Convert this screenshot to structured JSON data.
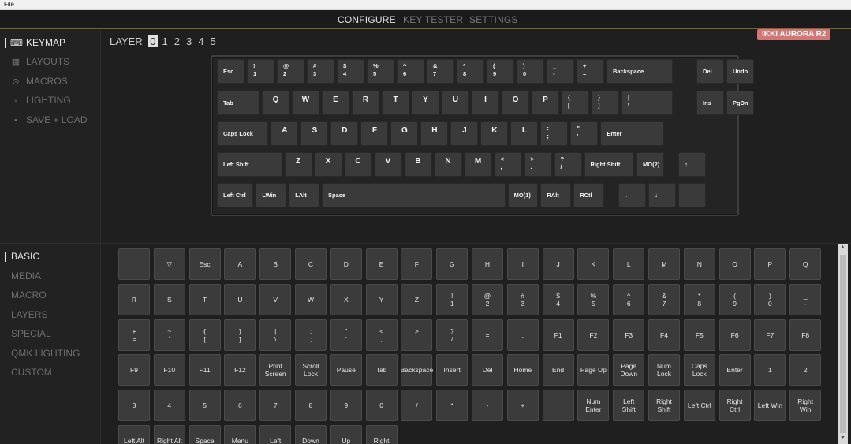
{
  "menubar": {
    "file": "File"
  },
  "topnav": {
    "tabs": [
      "CONFIGURE",
      "KEY TESTER",
      "SETTINGS"
    ]
  },
  "leftnav": {
    "items": [
      {
        "label": "KEYMAP",
        "icon": "keyboard-icon",
        "glyph": "⌨"
      },
      {
        "label": "LAYOUTS",
        "icon": "layouts-icon",
        "glyph": "▦"
      },
      {
        "label": "MACROS",
        "icon": "macros-icon",
        "glyph": "⊙"
      },
      {
        "label": "LIGHTING",
        "icon": "lightbulb-icon",
        "glyph": "♀"
      },
      {
        "label": "SAVE + LOAD",
        "icon": "save-icon",
        "glyph": "▪"
      }
    ]
  },
  "layer": {
    "label": "LAYER",
    "numbers": [
      "0",
      "1",
      "2",
      "3",
      "4",
      "5"
    ]
  },
  "device": {
    "name": "IKKI AURORA R2"
  },
  "keyboard": {
    "rows": [
      [
        [
          "Esc",
          ""
        ],
        [
          "!",
          "1"
        ],
        [
          "@",
          "2"
        ],
        [
          "#",
          "3"
        ],
        [
          "$",
          "4"
        ],
        [
          "%",
          "5"
        ],
        [
          "^",
          "6"
        ],
        [
          "&",
          "7"
        ],
        [
          "*",
          "8"
        ],
        [
          "(",
          "9"
        ],
        [
          ")",
          "0"
        ],
        [
          "_",
          "-"
        ],
        [
          "+",
          "="
        ],
        [
          "Backspace",
          ""
        ],
        [
          "Del",
          ""
        ],
        [
          "Undo",
          ""
        ]
      ],
      [
        [
          "Tab",
          ""
        ],
        [
          "Q",
          ""
        ],
        [
          "W",
          ""
        ],
        [
          "E",
          ""
        ],
        [
          "R",
          ""
        ],
        [
          "T",
          ""
        ],
        [
          "Y",
          ""
        ],
        [
          "U",
          ""
        ],
        [
          "I",
          ""
        ],
        [
          "O",
          ""
        ],
        [
          "P",
          ""
        ],
        [
          "{",
          "["
        ],
        [
          "}",
          "]"
        ],
        [
          "|",
          "\\"
        ],
        [
          "Ins",
          ""
        ],
        [
          "PgDn",
          ""
        ]
      ],
      [
        [
          "Caps Lock",
          ""
        ],
        [
          "A",
          ""
        ],
        [
          "S",
          ""
        ],
        [
          "D",
          ""
        ],
        [
          "F",
          ""
        ],
        [
          "G",
          ""
        ],
        [
          "H",
          ""
        ],
        [
          "J",
          ""
        ],
        [
          "K",
          ""
        ],
        [
          "L",
          ""
        ],
        [
          ":",
          ";"
        ],
        [
          "\"",
          "'"
        ],
        [
          "Enter",
          ""
        ]
      ],
      [
        [
          "Left Shift",
          ""
        ],
        [
          "Z",
          ""
        ],
        [
          "X",
          ""
        ],
        [
          "C",
          ""
        ],
        [
          "V",
          ""
        ],
        [
          "B",
          ""
        ],
        [
          "N",
          ""
        ],
        [
          "M",
          ""
        ],
        [
          "<",
          ","
        ],
        [
          ">",
          "."
        ],
        [
          "?",
          "/"
        ],
        [
          "Right Shift",
          ""
        ],
        [
          "MO(2)",
          ""
        ],
        [
          "↑",
          ""
        ]
      ],
      [
        [
          "Left Ctrl",
          ""
        ],
        [
          "LWin",
          ""
        ],
        [
          "LAlt",
          ""
        ],
        [
          "Space",
          ""
        ],
        [
          "MO(1)",
          ""
        ],
        [
          "RAlt",
          ""
        ],
        [
          "RCtl",
          ""
        ],
        [
          "←",
          ""
        ],
        [
          "↓",
          ""
        ],
        [
          "→",
          ""
        ]
      ]
    ]
  },
  "categories": [
    "BASIC",
    "MEDIA",
    "MACRO",
    "LAYERS",
    "SPECIAL",
    "QMK LIGHTING",
    "CUSTOM"
  ],
  "keycodes": [
    [
      "",
      "▽",
      "Esc",
      "A",
      "B",
      "C",
      "D",
      "E",
      "F",
      "G",
      "H",
      "I",
      "J",
      "K",
      "L",
      "M",
      "N",
      "O",
      "P",
      "Q"
    ],
    [
      "R",
      "S",
      "T",
      "U",
      "V",
      "W",
      "X",
      "Y",
      "Z",
      "!\n1",
      "@\n2",
      "#\n3",
      "$\n4",
      "%\n5",
      "^\n6",
      "&\n7",
      "*\n8",
      "(\n9",
      ")\n0",
      "_\n-"
    ],
    [
      "+\n=",
      "~\n`",
      "{\n[",
      "}\n]",
      "|\n\\",
      ":\n;",
      "\"\n'",
      "<\n,",
      ">\n.",
      "?\n/",
      "=",
      ",",
      "F1",
      "F2",
      "F3",
      "F4",
      "F5",
      "F6",
      "F7",
      "F8"
    ],
    [
      "F9",
      "F10",
      "F11",
      "F12",
      "Print\nScreen",
      "Scroll\nLock",
      "Pause",
      "Tab",
      "Backspace",
      "Insert",
      "Del",
      "Home",
      "End",
      "Page Up",
      "Page\nDown",
      "Num\nLock",
      "Caps\nLock",
      "Enter",
      "1",
      "2"
    ],
    [
      "3",
      "4",
      "5",
      "6",
      "7",
      "8",
      "9",
      "0",
      "/",
      "*",
      "-",
      "+",
      ".",
      "Num\nEnter",
      "Left\nShift",
      "Right\nShift",
      "Left Ctrl",
      "Right\nCtrl",
      "Left Win",
      "Right\nWin"
    ],
    [
      "Left Alt",
      "Right Alt",
      "Space",
      "Menu",
      "Left",
      "Down",
      "Up",
      "Right"
    ]
  ]
}
